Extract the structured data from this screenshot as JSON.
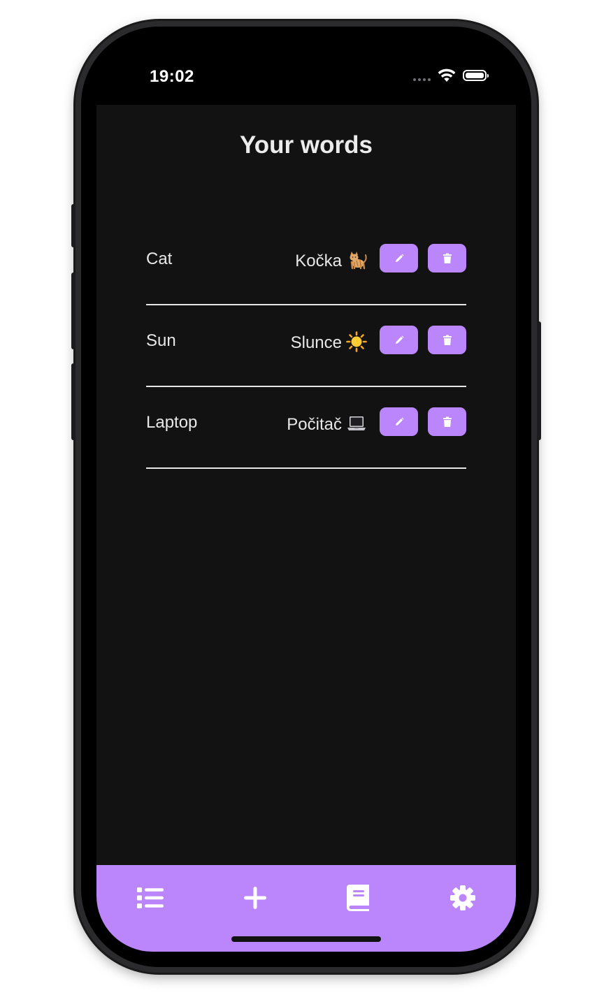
{
  "status_bar": {
    "time": "19:02",
    "icons": [
      "signal-dots-icon",
      "wifi-icon",
      "battery-icon"
    ]
  },
  "header": {
    "title": "Your words"
  },
  "words": [
    {
      "english": "Cat",
      "czech": "Kočka",
      "emoji": "cat-emoji-icon"
    },
    {
      "english": "Sun",
      "czech": "Slunce",
      "emoji": "sun-emoji-icon"
    },
    {
      "english": "Laptop",
      "czech": "Počitač",
      "emoji": "laptop-emoji-icon"
    }
  ],
  "row_actions": [
    "pencil-icon",
    "trash-icon"
  ],
  "bottom_nav": {
    "items": [
      {
        "name": "list-icon"
      },
      {
        "name": "plus-icon"
      },
      {
        "name": "book-icon"
      },
      {
        "name": "gear-icon"
      }
    ]
  },
  "colors": {
    "accent": "#bb86fc",
    "background": "#121212",
    "text": "#e8e8e8"
  }
}
